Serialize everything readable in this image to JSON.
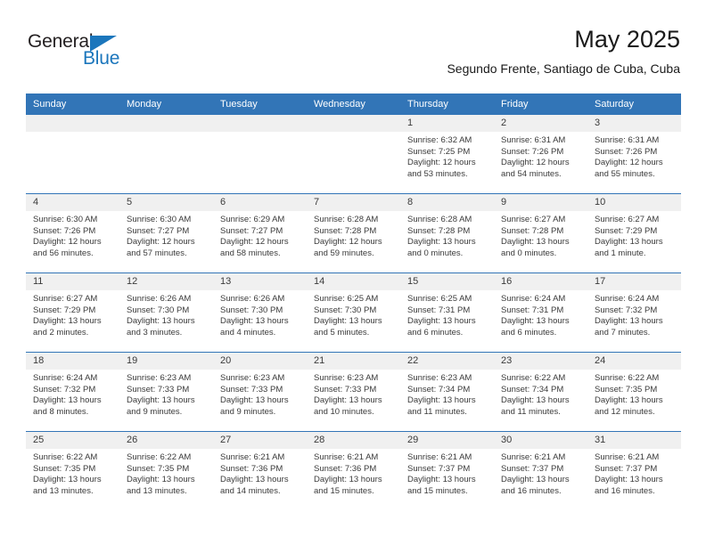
{
  "brand": {
    "name_part1": "General",
    "name_part2": "Blue",
    "triangle_icon": "blue-triangle-icon",
    "colors": {
      "dark": "#231f20",
      "blue": "#1b76bc"
    }
  },
  "header": {
    "title": "May 2025",
    "subtitle": "Segundo Frente, Santiago de Cuba, Cuba"
  },
  "colors": {
    "header_blue": "#3275b7",
    "daynum_band": "#f0f0f0",
    "text": "#3a3a3a"
  },
  "calendar": {
    "weekdays": [
      "Sunday",
      "Monday",
      "Tuesday",
      "Wednesday",
      "Thursday",
      "Friday",
      "Saturday"
    ],
    "weeks": [
      [
        {
          "day": "",
          "sunrise": "",
          "sunset": "",
          "daylight1": "",
          "daylight2": ""
        },
        {
          "day": "",
          "sunrise": "",
          "sunset": "",
          "daylight1": "",
          "daylight2": ""
        },
        {
          "day": "",
          "sunrise": "",
          "sunset": "",
          "daylight1": "",
          "daylight2": ""
        },
        {
          "day": "",
          "sunrise": "",
          "sunset": "",
          "daylight1": "",
          "daylight2": ""
        },
        {
          "day": "1",
          "sunrise": "Sunrise: 6:32 AM",
          "sunset": "Sunset: 7:25 PM",
          "daylight1": "Daylight: 12 hours",
          "daylight2": "and 53 minutes."
        },
        {
          "day": "2",
          "sunrise": "Sunrise: 6:31 AM",
          "sunset": "Sunset: 7:26 PM",
          "daylight1": "Daylight: 12 hours",
          "daylight2": "and 54 minutes."
        },
        {
          "day": "3",
          "sunrise": "Sunrise: 6:31 AM",
          "sunset": "Sunset: 7:26 PM",
          "daylight1": "Daylight: 12 hours",
          "daylight2": "and 55 minutes."
        }
      ],
      [
        {
          "day": "4",
          "sunrise": "Sunrise: 6:30 AM",
          "sunset": "Sunset: 7:26 PM",
          "daylight1": "Daylight: 12 hours",
          "daylight2": "and 56 minutes."
        },
        {
          "day": "5",
          "sunrise": "Sunrise: 6:30 AM",
          "sunset": "Sunset: 7:27 PM",
          "daylight1": "Daylight: 12 hours",
          "daylight2": "and 57 minutes."
        },
        {
          "day": "6",
          "sunrise": "Sunrise: 6:29 AM",
          "sunset": "Sunset: 7:27 PM",
          "daylight1": "Daylight: 12 hours",
          "daylight2": "and 58 minutes."
        },
        {
          "day": "7",
          "sunrise": "Sunrise: 6:28 AM",
          "sunset": "Sunset: 7:28 PM",
          "daylight1": "Daylight: 12 hours",
          "daylight2": "and 59 minutes."
        },
        {
          "day": "8",
          "sunrise": "Sunrise: 6:28 AM",
          "sunset": "Sunset: 7:28 PM",
          "daylight1": "Daylight: 13 hours",
          "daylight2": "and 0 minutes."
        },
        {
          "day": "9",
          "sunrise": "Sunrise: 6:27 AM",
          "sunset": "Sunset: 7:28 PM",
          "daylight1": "Daylight: 13 hours",
          "daylight2": "and 0 minutes."
        },
        {
          "day": "10",
          "sunrise": "Sunrise: 6:27 AM",
          "sunset": "Sunset: 7:29 PM",
          "daylight1": "Daylight: 13 hours",
          "daylight2": "and 1 minute."
        }
      ],
      [
        {
          "day": "11",
          "sunrise": "Sunrise: 6:27 AM",
          "sunset": "Sunset: 7:29 PM",
          "daylight1": "Daylight: 13 hours",
          "daylight2": "and 2 minutes."
        },
        {
          "day": "12",
          "sunrise": "Sunrise: 6:26 AM",
          "sunset": "Sunset: 7:30 PM",
          "daylight1": "Daylight: 13 hours",
          "daylight2": "and 3 minutes."
        },
        {
          "day": "13",
          "sunrise": "Sunrise: 6:26 AM",
          "sunset": "Sunset: 7:30 PM",
          "daylight1": "Daylight: 13 hours",
          "daylight2": "and 4 minutes."
        },
        {
          "day": "14",
          "sunrise": "Sunrise: 6:25 AM",
          "sunset": "Sunset: 7:30 PM",
          "daylight1": "Daylight: 13 hours",
          "daylight2": "and 5 minutes."
        },
        {
          "day": "15",
          "sunrise": "Sunrise: 6:25 AM",
          "sunset": "Sunset: 7:31 PM",
          "daylight1": "Daylight: 13 hours",
          "daylight2": "and 6 minutes."
        },
        {
          "day": "16",
          "sunrise": "Sunrise: 6:24 AM",
          "sunset": "Sunset: 7:31 PM",
          "daylight1": "Daylight: 13 hours",
          "daylight2": "and 6 minutes."
        },
        {
          "day": "17",
          "sunrise": "Sunrise: 6:24 AM",
          "sunset": "Sunset: 7:32 PM",
          "daylight1": "Daylight: 13 hours",
          "daylight2": "and 7 minutes."
        }
      ],
      [
        {
          "day": "18",
          "sunrise": "Sunrise: 6:24 AM",
          "sunset": "Sunset: 7:32 PM",
          "daylight1": "Daylight: 13 hours",
          "daylight2": "and 8 minutes."
        },
        {
          "day": "19",
          "sunrise": "Sunrise: 6:23 AM",
          "sunset": "Sunset: 7:33 PM",
          "daylight1": "Daylight: 13 hours",
          "daylight2": "and 9 minutes."
        },
        {
          "day": "20",
          "sunrise": "Sunrise: 6:23 AM",
          "sunset": "Sunset: 7:33 PM",
          "daylight1": "Daylight: 13 hours",
          "daylight2": "and 9 minutes."
        },
        {
          "day": "21",
          "sunrise": "Sunrise: 6:23 AM",
          "sunset": "Sunset: 7:33 PM",
          "daylight1": "Daylight: 13 hours",
          "daylight2": "and 10 minutes."
        },
        {
          "day": "22",
          "sunrise": "Sunrise: 6:23 AM",
          "sunset": "Sunset: 7:34 PM",
          "daylight1": "Daylight: 13 hours",
          "daylight2": "and 11 minutes."
        },
        {
          "day": "23",
          "sunrise": "Sunrise: 6:22 AM",
          "sunset": "Sunset: 7:34 PM",
          "daylight1": "Daylight: 13 hours",
          "daylight2": "and 11 minutes."
        },
        {
          "day": "24",
          "sunrise": "Sunrise: 6:22 AM",
          "sunset": "Sunset: 7:35 PM",
          "daylight1": "Daylight: 13 hours",
          "daylight2": "and 12 minutes."
        }
      ],
      [
        {
          "day": "25",
          "sunrise": "Sunrise: 6:22 AM",
          "sunset": "Sunset: 7:35 PM",
          "daylight1": "Daylight: 13 hours",
          "daylight2": "and 13 minutes."
        },
        {
          "day": "26",
          "sunrise": "Sunrise: 6:22 AM",
          "sunset": "Sunset: 7:35 PM",
          "daylight1": "Daylight: 13 hours",
          "daylight2": "and 13 minutes."
        },
        {
          "day": "27",
          "sunrise": "Sunrise: 6:21 AM",
          "sunset": "Sunset: 7:36 PM",
          "daylight1": "Daylight: 13 hours",
          "daylight2": "and 14 minutes."
        },
        {
          "day": "28",
          "sunrise": "Sunrise: 6:21 AM",
          "sunset": "Sunset: 7:36 PM",
          "daylight1": "Daylight: 13 hours",
          "daylight2": "and 15 minutes."
        },
        {
          "day": "29",
          "sunrise": "Sunrise: 6:21 AM",
          "sunset": "Sunset: 7:37 PM",
          "daylight1": "Daylight: 13 hours",
          "daylight2": "and 15 minutes."
        },
        {
          "day": "30",
          "sunrise": "Sunrise: 6:21 AM",
          "sunset": "Sunset: 7:37 PM",
          "daylight1": "Daylight: 13 hours",
          "daylight2": "and 16 minutes."
        },
        {
          "day": "31",
          "sunrise": "Sunrise: 6:21 AM",
          "sunset": "Sunset: 7:37 PM",
          "daylight1": "Daylight: 13 hours",
          "daylight2": "and 16 minutes."
        }
      ]
    ]
  }
}
